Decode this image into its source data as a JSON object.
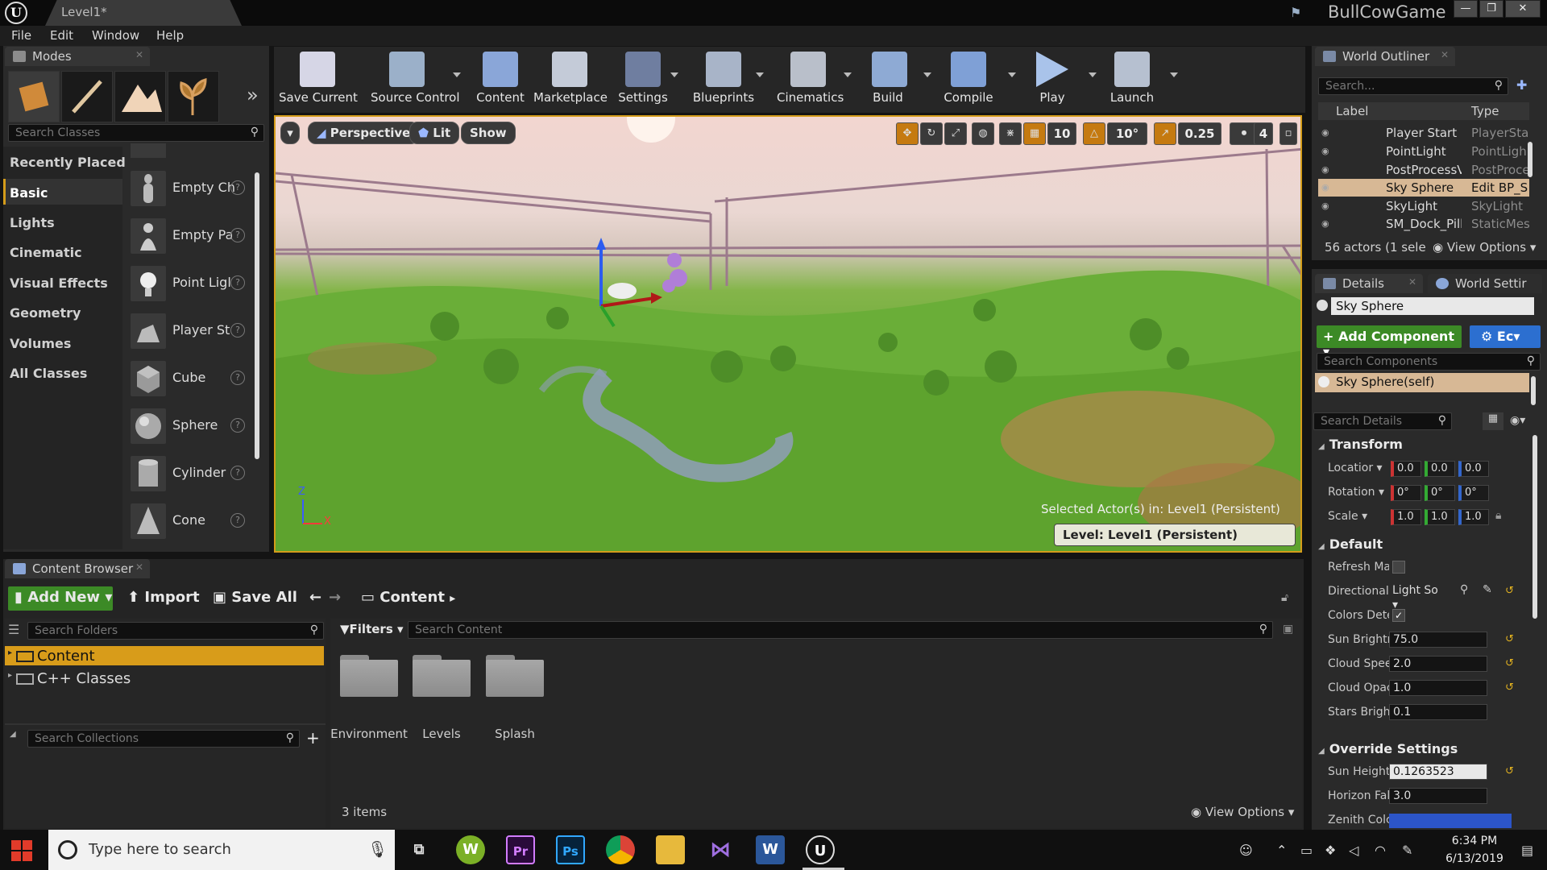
{
  "window": {
    "doc_tab": "Level1*",
    "project": "BullCowGame",
    "controls": [
      "—",
      "❐",
      "✕"
    ]
  },
  "menu": [
    "File",
    "Edit",
    "Window",
    "Help"
  ],
  "modes": {
    "tab": "Modes",
    "search_placeholder": "Search Classes",
    "categories": [
      "Recently Placed",
      "Basic",
      "Lights",
      "Cinematic",
      "Visual Effects",
      "Geometry",
      "Volumes",
      "All Classes"
    ],
    "selected_category": "Basic",
    "items": [
      "Empty Ch",
      "Empty Pa",
      "Point Ligl",
      "Player St",
      "Cube",
      "Sphere",
      "Cylinder",
      "Cone"
    ]
  },
  "toolbar": [
    {
      "label": "Save Current",
      "icon": "save-icon"
    },
    {
      "label": "Source Control",
      "icon": "source-control-icon"
    },
    {
      "label": "Content",
      "icon": "content-icon"
    },
    {
      "label": "Marketplace",
      "icon": "marketplace-icon"
    },
    {
      "label": "Settings",
      "icon": "settings-icon"
    },
    {
      "label": "Blueprints",
      "icon": "blueprints-icon"
    },
    {
      "label": "Cinematics",
      "icon": "cinematics-icon"
    },
    {
      "label": "Build",
      "icon": "build-icon"
    },
    {
      "label": "Compile",
      "icon": "compile-icon"
    },
    {
      "label": "Play",
      "icon": "play-icon"
    },
    {
      "label": "Launch",
      "icon": "launch-icon"
    }
  ],
  "viewport": {
    "perspective": "Perspective",
    "lit": "Lit",
    "show": "Show",
    "grid_snap": "10",
    "rotation_snap": "10°",
    "scale_snap": "0.25",
    "camera_speed": "4",
    "selected_actor_text": "Selected Actor(s) in: Level1 (Persistent)",
    "level_text": "Level:  Level1 (Persistent)",
    "axis_z": "Z",
    "axis_x": "X"
  },
  "outliner": {
    "tab": "World Outliner",
    "search_placeholder": "Search...",
    "col_label": "Label",
    "col_type": "Type",
    "rows": [
      {
        "label": "Player Start",
        "type": "PlayerSta"
      },
      {
        "label": "PointLight",
        "type": "PointLigh"
      },
      {
        "label": "PostProcessVc",
        "type": "PostProce"
      },
      {
        "label": "Sky Sphere",
        "type": "Edit BP_S"
      },
      {
        "label": "SkyLight",
        "type": "SkyLight"
      },
      {
        "label": "SM_Dock_Pillar",
        "type": "StaticMes"
      }
    ],
    "selected_row": 3,
    "footer": "56 actors (1 sele",
    "view_options": "View Options"
  },
  "details": {
    "tab": "Details",
    "tab2": "World Settir",
    "actor_name": "Sky Sphere",
    "add_component": "+ Add Component",
    "edit_blueprint": "Ec",
    "search_components": "Search Components",
    "component_self": "Sky Sphere(self)",
    "search_details": "Search Details",
    "transform": "Transform",
    "location_label": "Locatior",
    "rotation_label": "Rotation",
    "scale_label": "Scale",
    "location": [
      "0.0",
      "0.0",
      "0.0"
    ],
    "rotation": [
      "0°",
      "0°",
      "0°"
    ],
    "scale": [
      "1.0",
      "1.0",
      "1.0"
    ],
    "default": "Default",
    "props": [
      {
        "label": "Refresh Ma",
        "value": ""
      },
      {
        "label": "Directional",
        "value": "Light So"
      },
      {
        "label": "Colors Dete",
        "value": ""
      },
      {
        "label": "Sun Brightr",
        "value": "75.0"
      },
      {
        "label": "Cloud Spee",
        "value": "2.0"
      },
      {
        "label": "Cloud Opac",
        "value": "1.0"
      },
      {
        "label": "Stars Brigh",
        "value": "0.1"
      }
    ],
    "override": "Override Settings",
    "override_props": [
      {
        "label": "Sun Height",
        "value": "0.1263523"
      },
      {
        "label": "Horizon Fal",
        "value": "3.0"
      },
      {
        "label": "Zenith Colc",
        "value": ""
      }
    ],
    "zenith_color": "#2c55c8"
  },
  "content_browser": {
    "tab": "Content Browser",
    "add_new": "Add New",
    "import": "Import",
    "save_all": "Save All",
    "path": "Content",
    "search_folders": "Search Folders",
    "tree": [
      "Content",
      "C++ Classes"
    ],
    "search_collections": "Search Collections",
    "filters": "Filters",
    "search_content": "Search Content",
    "folders": [
      "Environment",
      "Levels",
      "Splash"
    ],
    "item_count": "3 items",
    "view_options": "View Options"
  },
  "taskbar": {
    "search_placeholder": "Type here to search",
    "time": "6:34 PM",
    "date": "6/13/2019"
  }
}
